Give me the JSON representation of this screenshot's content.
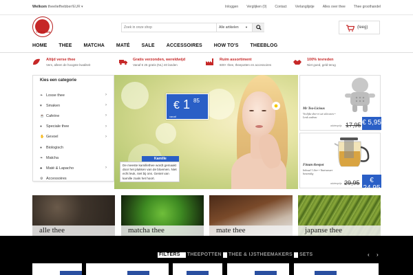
{
  "topbar": {
    "welcome_prefix": "Welkom ",
    "welcome_name": "theeliefhebber!",
    "currency": "EUR",
    "links": [
      "Inloggen",
      "Verglijken (0)",
      "Contact",
      "Verlanglijstje",
      "Alles over thee",
      "Thee groothandel"
    ]
  },
  "logo": {
    "text": "THEE & TEA"
  },
  "search": {
    "placeholder": "Zoek in onze shop",
    "category": "Alle artikelen"
  },
  "cart": {
    "label": "(leeg)"
  },
  "nav": [
    "HOME",
    "THEE",
    "MATCHA",
    "MATÉ",
    "SALE",
    "ACCESSOIRES",
    "HOW TO'S",
    "THEEBLOG"
  ],
  "usps": [
    {
      "title": "Altijd verse thee",
      "sub": "Vers, alleen de hoogste kwaliteit",
      "icon": "leaf-icon"
    },
    {
      "title": "Gratis verzonden, wereldwijd",
      "sub": "Vanaf € 25 gratis (NL) 40 landen",
      "icon": "truck-icon"
    },
    {
      "title": "Ruim assortiment",
      "sub": "600+ thee, theepotten en accessoires",
      "icon": "factory-icon"
    },
    {
      "title": "100% tevreden",
      "sub": "Niet goed, geld terug",
      "icon": "handshake-icon"
    }
  ],
  "categories": {
    "title": "Kies een categorie",
    "items": [
      {
        "label": "Losse thee",
        "icon": "leaf-icon",
        "has_children": true
      },
      {
        "label": "Smaken",
        "icon": "heart-icon",
        "has_children": true
      },
      {
        "label": "Cafeïne",
        "icon": "coffee-icon",
        "has_children": true
      },
      {
        "label": "Speciale thee",
        "icon": "star-icon",
        "has_children": true
      },
      {
        "label": "Gevoel",
        "icon": "thumbs-up-icon",
        "has_children": true
      },
      {
        "label": "Biologisch",
        "icon": "globe-icon",
        "has_children": false
      },
      {
        "label": "Matcha",
        "icon": "leaf-icon",
        "has_children": false
      },
      {
        "label": "Maté & Lapacho",
        "icon": "cup-icon",
        "has_children": true
      },
      {
        "label": "Accessoires",
        "icon": "gear-icon",
        "has_children": false
      }
    ]
  },
  "hero": {
    "currency": "€",
    "price_main": "1",
    "price_cents": "85",
    "price_prefix": "vanaf",
    "tag": "Kamille",
    "description": "De meeste kamillethee wordt gemaakt door het plukken van de bloemen. Niet echt leuk, niet bij ons. Geniet van kamille zoals het hoort."
  },
  "products": [
    {
      "name": "Mr Tea-Licious",
      "sub": "Vrolijke thee-ei uit siliconen • Leuk cadeau",
      "advies_label": "adviesprijs",
      "old_price": "17,95",
      "price": "€ 5,95"
    },
    {
      "name": "Finum theepot",
      "sub": "Inhoud 1 liter • Vaatwasser bestendig",
      "advies_label": "adviesprijs",
      "old_price": "29,95",
      "price": "€ 24,95"
    }
  ],
  "tiles": [
    "alle thee",
    "matcha thee",
    "mate thee",
    "japanse thee"
  ],
  "filters": [
    "FILTERS",
    "THEEPOTTEN",
    "THEE & IJSTHEEMAKERS",
    "SETS"
  ],
  "colors": {
    "brand_red": "#c62828",
    "brand_blue": "#2a5fc6"
  }
}
